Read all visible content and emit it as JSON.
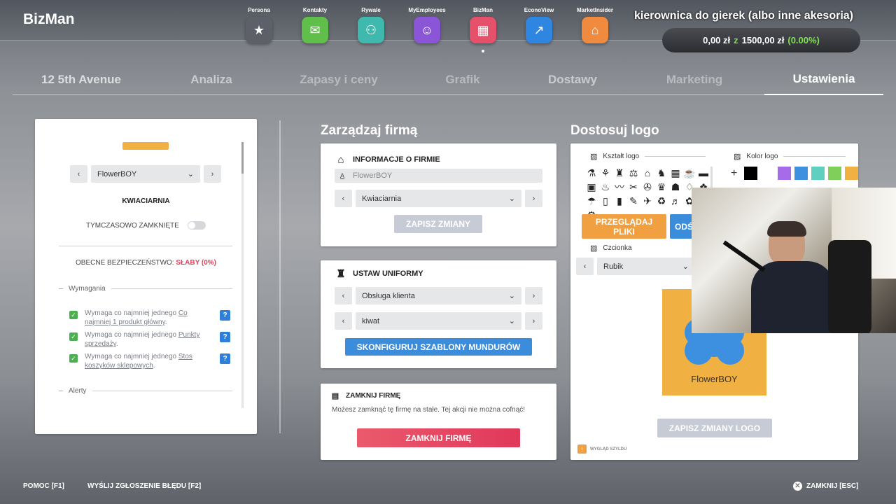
{
  "app": {
    "brand": "BizMan"
  },
  "apps": [
    {
      "label": "Persona",
      "color": "#5d6068",
      "icon": "★"
    },
    {
      "label": "Kontakty",
      "color": "#5fbf4a",
      "icon": "✉"
    },
    {
      "label": "Rywale",
      "color": "#3fb9ad",
      "icon": "⚇"
    },
    {
      "label": "MyEmployees",
      "color": "#8a55d6",
      "icon": "☺"
    },
    {
      "label": "BizMan",
      "color": "#e5506a",
      "icon": "▦"
    },
    {
      "label": "EconoView",
      "color": "#2f86e0",
      "icon": "↗"
    },
    {
      "label": "MarketInsider",
      "color": "#f08a3e",
      "icon": "⌂"
    }
  ],
  "stream": {
    "title": "kierownica do gierek (albo inne akesoria)"
  },
  "money": {
    "balance": "0,00 zł",
    "z": "z",
    "total": "1500,00 zł",
    "pct": "(0.00%)"
  },
  "tabs": [
    "12 5th Avenue",
    "Analiza",
    "Zapasy i ceny",
    "Grafik",
    "Dostawy",
    "Marketing",
    "Ustawienia"
  ],
  "left": {
    "company_select": "FlowerBOY",
    "type": "KWIACIARNIA",
    "temp_closed": "TYMCZASOWO ZAMKNIĘTE",
    "security_label": "OBECNE BEZPIECZEŃSTWO:",
    "security_value": "SŁABY (0%)",
    "requirements_title": "Wymagania",
    "requirements": [
      {
        "pre": "Wymaga co najmniej jednego ",
        "link": "Co najmniej 1 produkt główny",
        "post": "."
      },
      {
        "pre": "Wymaga co najmniej jednego ",
        "link": "Punkty sprzedaży",
        "post": "."
      },
      {
        "pre": "Wymaga co najmniej jednego ",
        "link": "Stos koszyków sklepowych",
        "post": "."
      }
    ],
    "alerts_title": "Alerty"
  },
  "manage": {
    "title": "Zarządzaj firmą",
    "info_title": "INFORMACJE O FIRMIE",
    "name_value": "FlowerBOY",
    "type_value": "Kwiaciarnia",
    "save_label": "ZAPISZ ZMIANY",
    "uniform_title": "USTAW UNIFORMY",
    "uniform_role": "Obsługa klienta",
    "uniform_item": "kiwat",
    "configure_label": "SKONFIGURUJ SZABLONY MUNDURÓW",
    "close_title": "ZAMKNIJ FIRMĘ",
    "close_desc": "Możesz zamknąć tę firmę na stałe. Tej akcji nie można cofnąć!",
    "close_label": "ZAMKNIJ FIRMĘ"
  },
  "logo": {
    "title": "Dostosuj logo",
    "shape_title": "Kształt logo",
    "color_title": "Kolor logo",
    "plus": "+",
    "colors": [
      "#000000",
      "#ffffff",
      "#a66be8",
      "#3d8fe0",
      "#5fd0c0",
      "#7fcf5a",
      "#f0b042"
    ],
    "icons": [
      "⚗",
      "⚘",
      "♜",
      "⚖",
      "⌂",
      "♞",
      "▦",
      "☕",
      "▬",
      "▣",
      "♨",
      "〰",
      "✂",
      "✇",
      "♛",
      "☗",
      "♢",
      "❖",
      "☂",
      "▯",
      "▮",
      "✎",
      "✈",
      "♻",
      "♬",
      "✿",
      "♣",
      "⚙"
    ],
    "browse_label": "PRZEGLĄDAJ PLIKI",
    "reset_label": "ODŚ",
    "font_title": "Czcionka",
    "font_value": "Rubik",
    "preview_name": "FlowerBOY",
    "save_logo_label": "ZAPISZ ZMIANY LOGO",
    "footer_label": "WYGLĄD SZYLDU"
  },
  "footer": {
    "help": "POMOC [F1]",
    "report": "WYŚLIJ ZGŁOSZENIE BŁĘDU [F2]",
    "close": "ZAMKNIJ [ESC]"
  }
}
